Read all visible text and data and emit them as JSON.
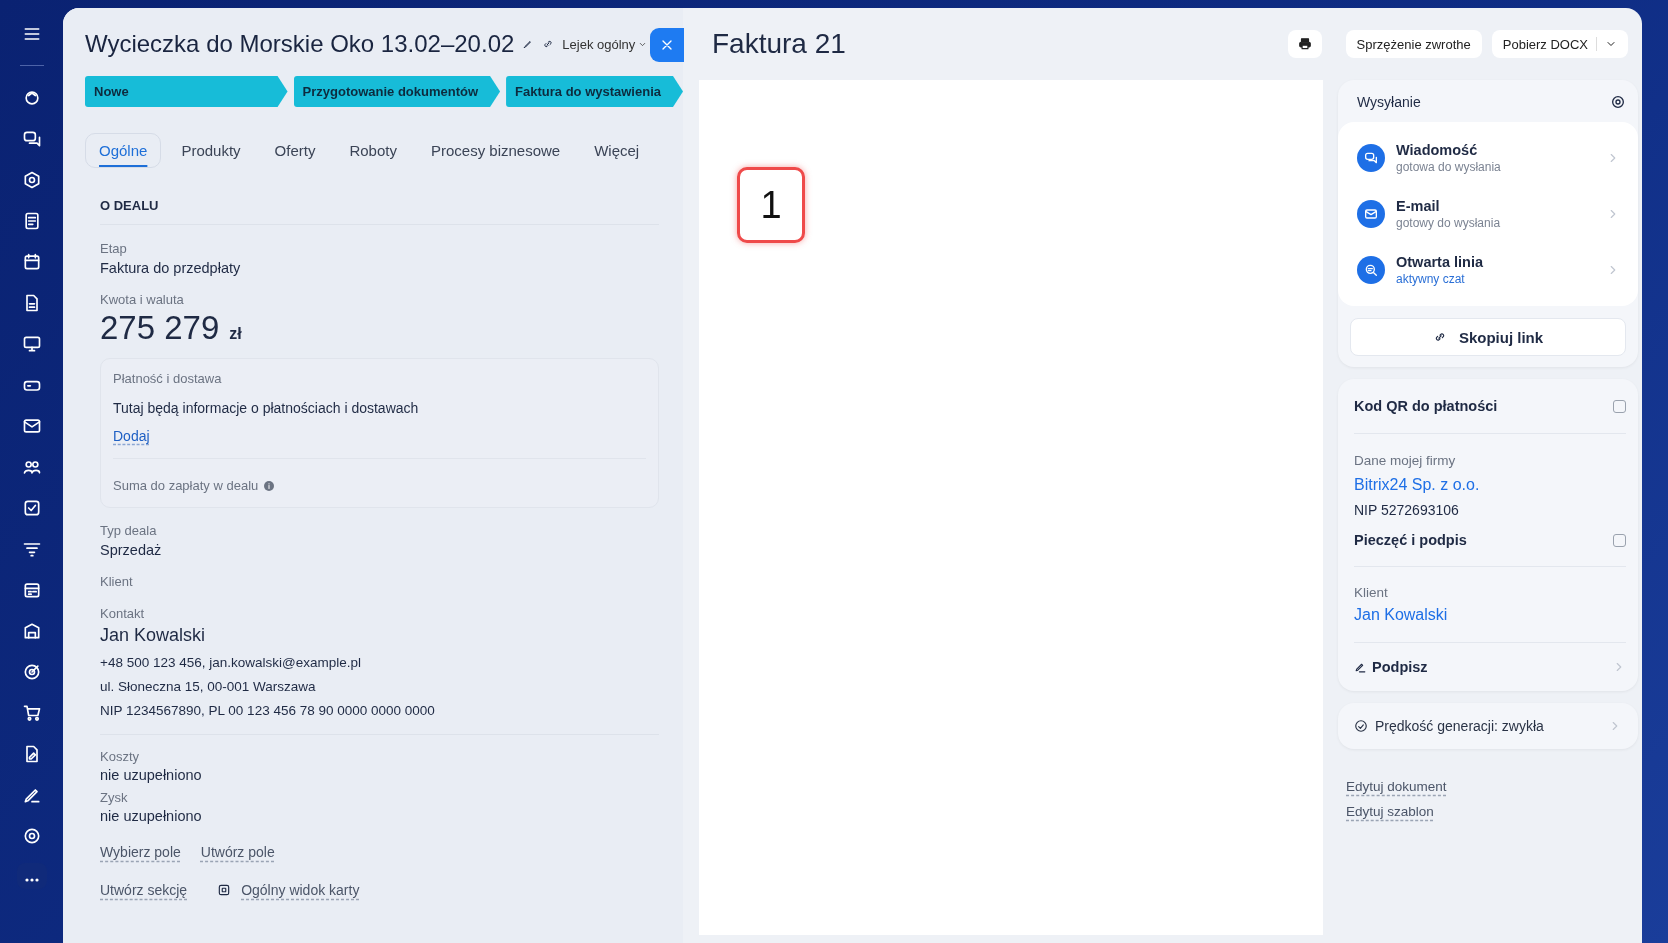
{
  "deal": {
    "title": "Wycieczka do Morskie Oko 13.02–20.02",
    "funnel": "Lejek ogólny",
    "stages": [
      {
        "label": "Nowe"
      },
      {
        "label": "Przygotowanie dokumentów"
      },
      {
        "label": "Faktura do wystawienia"
      }
    ],
    "tabs": [
      {
        "label": "Ogólne",
        "selected": true
      },
      {
        "label": "Produkty",
        "selected": false
      },
      {
        "label": "Oferty",
        "selected": false
      },
      {
        "label": "Roboty",
        "selected": false
      },
      {
        "label": "Procesy biznesowe",
        "selected": false
      },
      {
        "label": "Więcej",
        "selected": false
      }
    ],
    "section_title": "O DEALU",
    "stage_label": "Etap",
    "stage_value": "Faktura do przedpłaty",
    "amount_label": "Kwota i waluta",
    "amount": "275 279",
    "currency": "zł",
    "payment": {
      "title": "Płatność i dostawa",
      "text": "Tutaj będą informacje o płatnościach i dostawach",
      "add_link": "Dodaj",
      "sum_label": "Suma do zapłaty w dealu"
    },
    "type_label": "Typ deala",
    "type_value": "Sprzedaż",
    "client_label": "Klient",
    "contact_label": "Kontakt",
    "contact_name": "Jan Kowalski",
    "contact_lines": [
      "+48 500 123 456, jan.kowalski@example.pl",
      "ul. Słoneczna 15, 00-001 Warszawa",
      "NIP 1234567890, PL 00 123 456 78 90 0000 0000 0000"
    ],
    "costs_label": "Koszty",
    "costs_value": "nie uzupełniono",
    "profit_label": "Zysk",
    "profit_value": "nie uzupełniono",
    "field_links": [
      "Wybierz pole",
      "Utwórz pole"
    ],
    "create_section": "Utwórz sekcję",
    "card_view": "Ogólny widok karty"
  },
  "document": {
    "title": "Faktura 21",
    "feedback_button": "Sprzężenie zwrothe",
    "download_button": "Pobierz DOCX",
    "callout_marker": "1"
  },
  "sending": {
    "title": "Wysyłanie",
    "channels": [
      {
        "name": "Wiadomość",
        "status": "gotowa do wysłania",
        "active": false
      },
      {
        "name": "E-mail",
        "status": "gotowy do wysłania",
        "active": false
      },
      {
        "name": "Otwarta linia",
        "status": "aktywny czat",
        "active": true
      }
    ],
    "copy_link": "Skopiuj link"
  },
  "settings": {
    "qr_label": "Kod QR do płatności",
    "qr_checked": false,
    "company_label": "Dane mojej firmy",
    "company_name": "Bitrix24 Sp. z o.o.",
    "company_nip": "NIP 5272693106",
    "stamp_label": "Pieczęć i podpis",
    "stamp_checked": false,
    "client_label": "Klient",
    "client_name": "Jan Kowalski",
    "sign": "Podpisz"
  },
  "speed": {
    "label": "Prędkość generacji:",
    "value": "zwykła"
  },
  "edit_links": [
    "Edytuj dokument",
    "Edytuj szablon"
  ]
}
